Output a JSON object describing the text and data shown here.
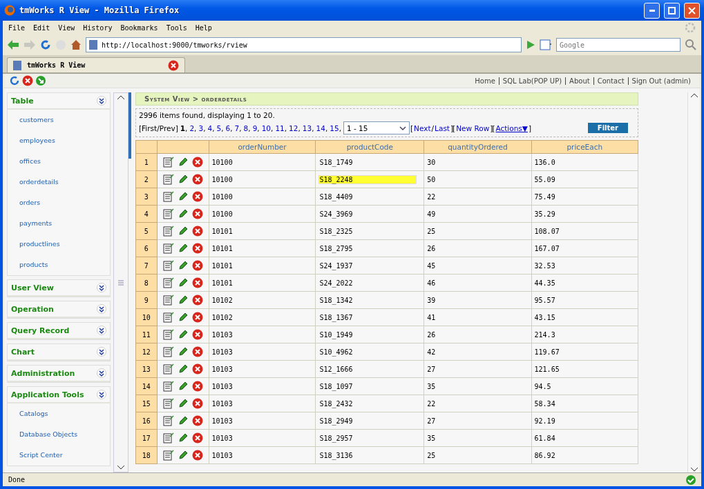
{
  "window": {
    "title": "tmWorks R View - Mozilla Firefox"
  },
  "menu": [
    "File",
    "Edit",
    "View",
    "History",
    "Bookmarks",
    "Tools",
    "Help"
  ],
  "address_bar": {
    "value": "http://localhost:9000/tmworks/rview"
  },
  "search": {
    "placeholder": "Google"
  },
  "browser_tab": {
    "title": "tmWorks R View"
  },
  "top_links": [
    "Home",
    "SQL Lab(POP UP)",
    "About",
    "Contact",
    "Sign Out (admin)"
  ],
  "sidebar": [
    {
      "title": "Table",
      "items": [
        "customers",
        "employees",
        "offices",
        "orderdetails",
        "orders",
        "payments",
        "productlines",
        "products"
      ]
    },
    {
      "title": "User View"
    },
    {
      "title": "Operation"
    },
    {
      "title": "Query Record"
    },
    {
      "title": "Chart"
    },
    {
      "title": "Administration"
    },
    {
      "title": "Application Tools",
      "items": [
        "Catalogs",
        "Database Objects",
        "Script Center"
      ]
    }
  ],
  "breadcrumb": "System View > orderdetails",
  "summary": "2996 items found, displaying 1 to 20.",
  "pager": {
    "first_prev": "[First/Prev]",
    "separator": ",",
    "pages": [
      {
        "label": "1",
        "selected": true
      },
      {
        "label": "2",
        "selected": false
      },
      {
        "label": "3",
        "selected": false
      },
      {
        "label": "4",
        "selected": false
      },
      {
        "label": "5",
        "selected": false
      },
      {
        "label": "6",
        "selected": false
      },
      {
        "label": "7",
        "selected": false
      },
      {
        "label": "8",
        "selected": false
      },
      {
        "label": "9",
        "selected": false
      },
      {
        "label": "10",
        "selected": false
      },
      {
        "label": "11",
        "selected": false
      },
      {
        "label": "12",
        "selected": false
      },
      {
        "label": "13",
        "selected": false
      },
      {
        "label": "14",
        "selected": false
      },
      {
        "label": "15",
        "selected": false
      }
    ],
    "range": "1 - 15",
    "controls": [
      {
        "kind": "text",
        "text": "["
      },
      {
        "kind": "link",
        "text": "Next"
      },
      {
        "kind": "text",
        "text": "/"
      },
      {
        "kind": "link",
        "text": "Last"
      },
      {
        "kind": "text",
        "text": "]"
      },
      {
        "kind": "text",
        "text": "["
      },
      {
        "kind": "link",
        "text": "New Row"
      },
      {
        "kind": "text",
        "text": "]"
      },
      {
        "kind": "text",
        "text": "["
      },
      {
        "kind": "menu",
        "text": "Actions▼"
      },
      {
        "kind": "text",
        "text": "]"
      }
    ],
    "filter": "Filter"
  },
  "table": {
    "columns": [
      "orderNumber",
      "productCode",
      "quantityOrdered",
      "priceEach"
    ],
    "rows": [
      {
        "n": "1",
        "cells": [
          "10100",
          "S18_1749",
          "30",
          "136.0"
        ],
        "highlighted": false
      },
      {
        "n": "2",
        "cells": [
          "10100",
          "S18_2248",
          "50",
          "55.09"
        ],
        "highlighted": true
      },
      {
        "n": "3",
        "cells": [
          "10100",
          "S18_4409",
          "22",
          "75.49"
        ],
        "highlighted": false
      },
      {
        "n": "4",
        "cells": [
          "10100",
          "S24_3969",
          "49",
          "35.29"
        ],
        "highlighted": false
      },
      {
        "n": "5",
        "cells": [
          "10101",
          "S18_2325",
          "25",
          "108.07"
        ],
        "highlighted": false
      },
      {
        "n": "6",
        "cells": [
          "10101",
          "S18_2795",
          "26",
          "167.07"
        ],
        "highlighted": false
      },
      {
        "n": "7",
        "cells": [
          "10101",
          "S24_1937",
          "45",
          "32.53"
        ],
        "highlighted": false
      },
      {
        "n": "8",
        "cells": [
          "10101",
          "S24_2022",
          "46",
          "44.35"
        ],
        "highlighted": false
      },
      {
        "n": "9",
        "cells": [
          "10102",
          "S18_1342",
          "39",
          "95.57"
        ],
        "highlighted": false
      },
      {
        "n": "10",
        "cells": [
          "10102",
          "S18_1367",
          "41",
          "43.15"
        ],
        "highlighted": false
      },
      {
        "n": "11",
        "cells": [
          "10103",
          "S10_1949",
          "26",
          "214.3"
        ],
        "highlighted": false
      },
      {
        "n": "12",
        "cells": [
          "10103",
          "S10_4962",
          "42",
          "119.67"
        ],
        "highlighted": false
      },
      {
        "n": "13",
        "cells": [
          "10103",
          "S12_1666",
          "27",
          "121.65"
        ],
        "highlighted": false
      },
      {
        "n": "14",
        "cells": [
          "10103",
          "S18_1097",
          "35",
          "94.5"
        ],
        "highlighted": false
      },
      {
        "n": "15",
        "cells": [
          "10103",
          "S18_2432",
          "22",
          "58.34"
        ],
        "highlighted": false
      },
      {
        "n": "16",
        "cells": [
          "10103",
          "S18_2949",
          "27",
          "92.19"
        ],
        "highlighted": false
      },
      {
        "n": "17",
        "cells": [
          "10103",
          "S18_2957",
          "35",
          "61.84"
        ],
        "highlighted": false
      },
      {
        "n": "18",
        "cells": [
          "10103",
          "S18_3136",
          "25",
          "86.92"
        ],
        "highlighted": false
      }
    ]
  },
  "status_bar": {
    "text": "Done"
  }
}
